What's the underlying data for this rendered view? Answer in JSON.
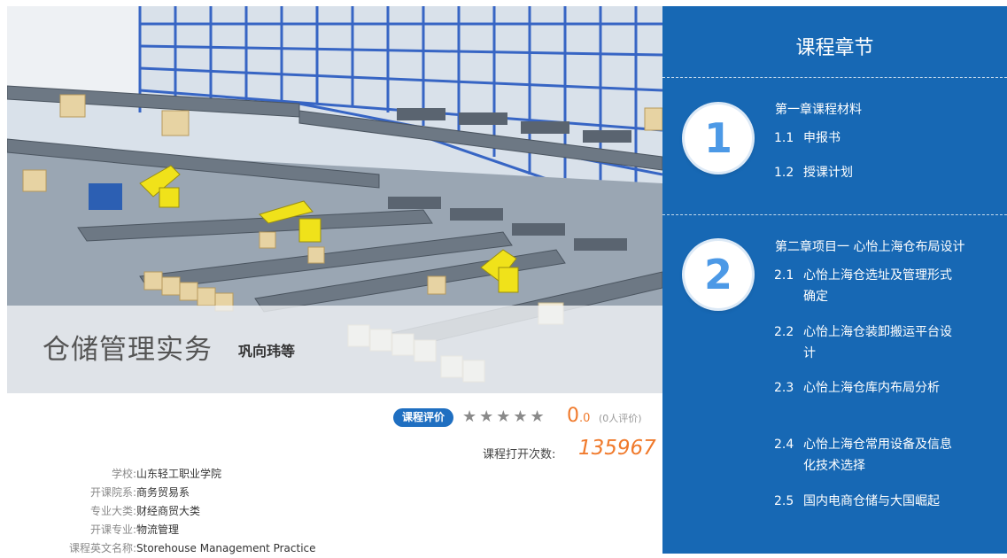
{
  "course": {
    "title": "仓储管理实务",
    "author": "巩向玮等"
  },
  "rating": {
    "badge": "课程评价",
    "stars": "★★★★★",
    "score_int": "0",
    "score_dec": ".0",
    "count": "(0人评价)"
  },
  "opens": {
    "label": "课程打开次数:",
    "value": "135967"
  },
  "info": [
    {
      "label": "学校:",
      "value": "山东轻工职业学院"
    },
    {
      "label": "开课院系:",
      "value": "商务贸易系"
    },
    {
      "label": "专业大类:",
      "value": "财经商贸大类"
    },
    {
      "label": "开课专业:",
      "value": "物流管理"
    },
    {
      "label": "课程英文名称:",
      "value": "Storehouse Management Practice"
    }
  ],
  "chapters_panel": {
    "title": "课程章节",
    "chapters": [
      {
        "number": "1",
        "title": "第一章课程材料",
        "sections": [
          {
            "num": "1.1",
            "text": "申报书"
          },
          {
            "num": "1.2",
            "text": "授课计划"
          }
        ]
      },
      {
        "number": "2",
        "title": "第二章项目一 心怡上海仓布局设计",
        "sections": [
          {
            "num": "2.1",
            "text": "心怡上海仓选址及管理形式确定"
          },
          {
            "num": "2.2",
            "text": "心怡上海仓装卸搬运平台设计"
          },
          {
            "num": "2.3",
            "text": "心怡上海仓库内布局分析"
          },
          {
            "num": "2.4",
            "text": "心怡上海仓常用设备及信息化技术选择"
          },
          {
            "num": "2.5",
            "text": "国内电商仓储与大国崛起"
          }
        ]
      }
    ]
  },
  "colors": {
    "panel_blue": "#1768b4",
    "badge_blue": "#1f6fc1",
    "accent_orange": "#f07a2c",
    "circle_digit": "#4c99e6"
  }
}
